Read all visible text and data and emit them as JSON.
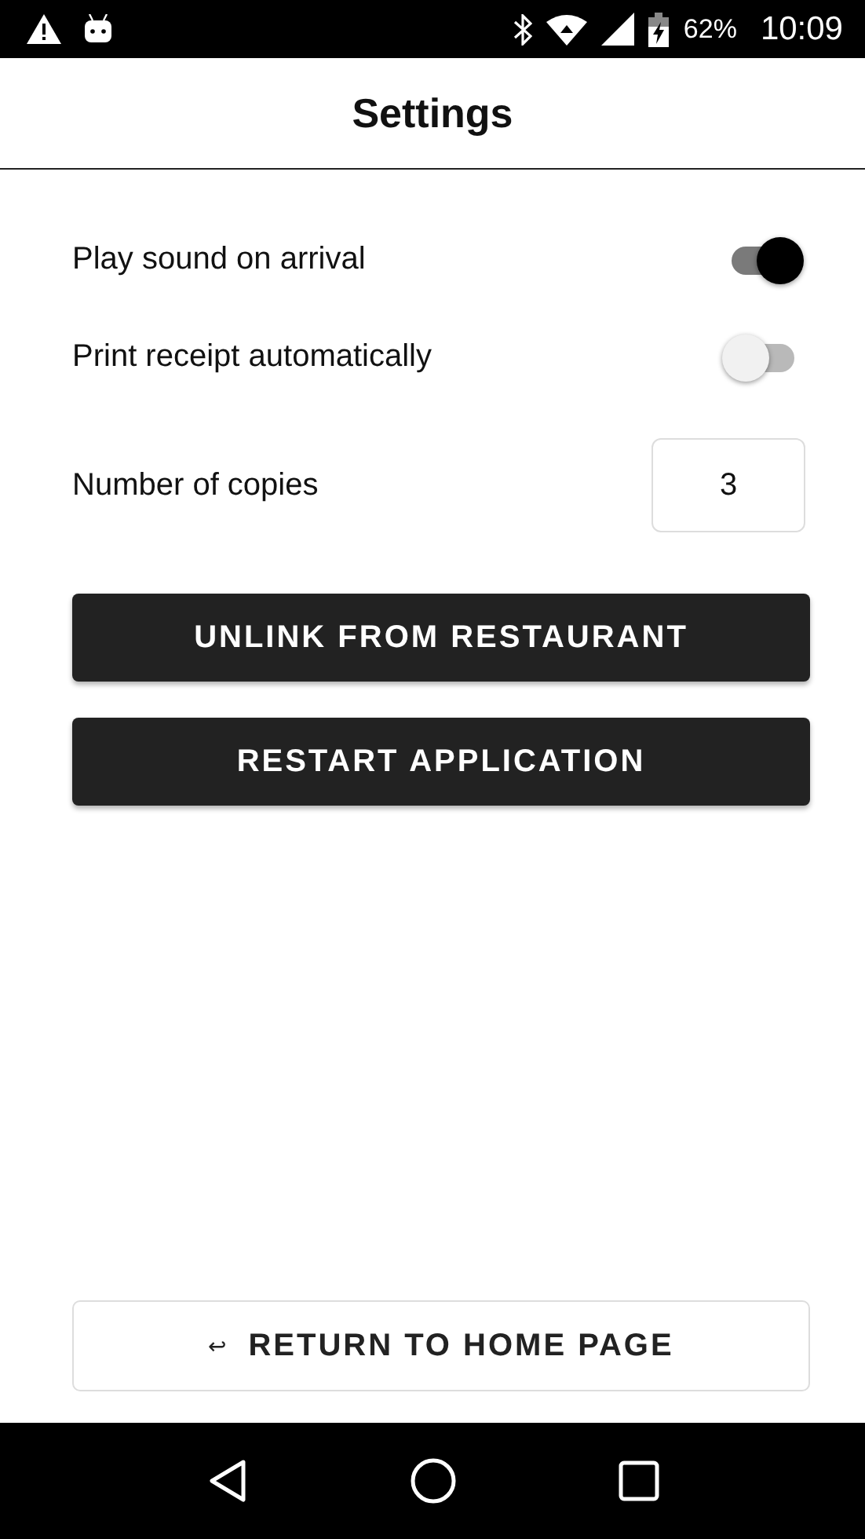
{
  "status_bar": {
    "battery": "62%",
    "time": "10:09"
  },
  "header": {
    "title": "Settings"
  },
  "settings": [
    {
      "kind": "toggle",
      "label": "Play sound on arrival",
      "on": true
    },
    {
      "kind": "toggle",
      "label": "Print receipt automatically",
      "on": false
    },
    {
      "kind": "number",
      "label": "Number of copies",
      "value": "3"
    }
  ],
  "actions": [
    "UNLINK FROM RESTAURANT",
    "RESTART APPLICATION"
  ],
  "return_button": {
    "icon": "↩",
    "label": "RETURN TO HOME PAGE"
  }
}
